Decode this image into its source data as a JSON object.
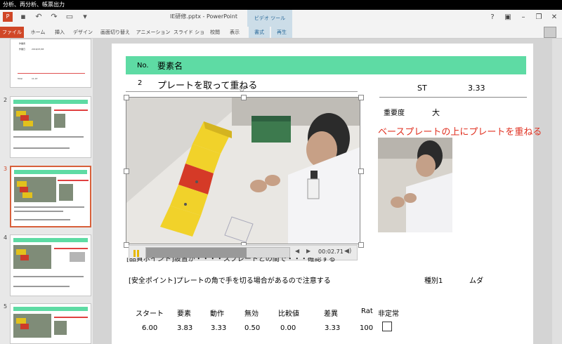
{
  "window": {
    "top_bar": "分析、再分析、帳票出力",
    "title": "IE研修.pptx - PowerPoint",
    "contextual_group": "ビデオ ツール"
  },
  "ribbon": {
    "tabs": [
      "ファイル",
      "ホーム",
      "挿入",
      "デザイン",
      "画面切り替え",
      "アニメーション",
      "スライド ショー",
      "校閲",
      "表示",
      "書式",
      "再生"
    ]
  },
  "thumbnails": {
    "numbers": [
      "2",
      "3",
      "4",
      "5"
    ],
    "selected": "3",
    "slide1_texts": [
      "作業者",
      "作業日",
      "2016/07/28",
      "Total",
      "11.07"
    ]
  },
  "slide": {
    "header": {
      "no_label": "No.",
      "name_label": "要素名"
    },
    "row": {
      "no": "2",
      "name": "プレートを取って重ねる"
    },
    "st_label": "ST",
    "st_value": "3.33",
    "importance_label": "重要度",
    "importance_value": "大",
    "red_note": "ベースプレートの上にプレートを重ねる",
    "player": {
      "time": "00:02.71",
      "progress": 0.7
    },
    "partial_text": "[品質ポイント]設置が・・・・スプレートとの間で・・・確認する",
    "safety_text": "[安全ポイント]プレートの角で手を切る場合があるので注意する",
    "category_label": "種別1",
    "category_value": "ムダ",
    "table": {
      "headers": [
        "スタート",
        "要素",
        "動作",
        "無効",
        "比較値",
        "差異",
        "Rat",
        "非定常"
      ],
      "values": [
        "6.00",
        "3.83",
        "3.33",
        "0.50",
        "0.00",
        "3.33",
        "100"
      ]
    }
  },
  "colors": {
    "accent_green": "#5edba4",
    "file_tab": "#d04727",
    "red_note": "#e03020"
  }
}
